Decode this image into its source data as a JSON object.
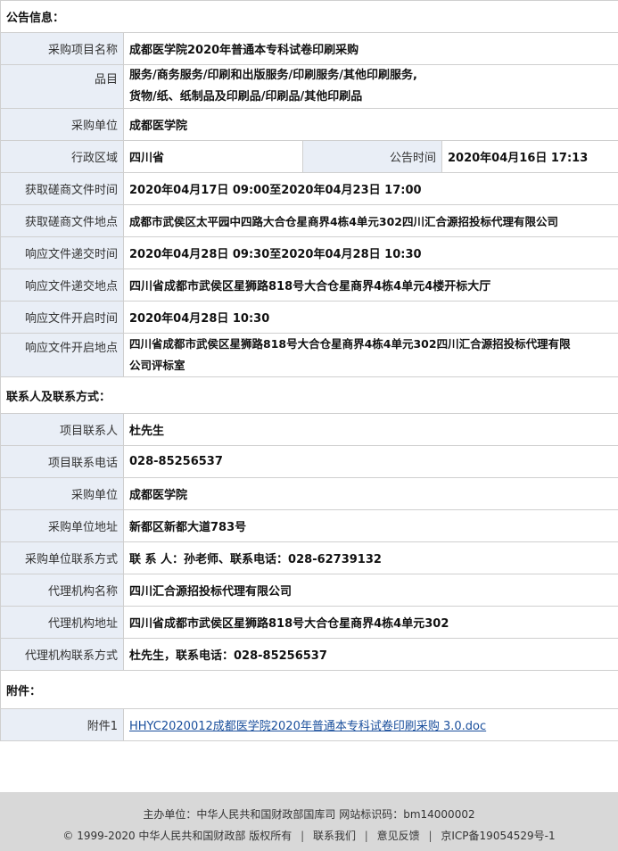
{
  "sections": {
    "announcement": "公告信息：",
    "contacts": "联系人及联系方式：",
    "attachments": "附件："
  },
  "announcement_rows": {
    "project_name": {
      "label": "采购项目名称",
      "value": "成都医学院2020年普通本专科试卷印刷采购"
    },
    "category": {
      "label": "品目",
      "value_line1": "服务/商务服务/印刷和出版服务/印刷服务/其他印刷服务,",
      "value_line2": "货物/纸、纸制品及印刷品/印刷品/其他印刷品"
    },
    "purchaser": {
      "label": "采购单位",
      "value": "成都医学院"
    },
    "region": {
      "label": "行政区域",
      "value": "四川省",
      "time_label": "公告时间",
      "time_value": "2020年04月16日 17:13"
    },
    "get_doc_time": {
      "label": "获取磋商文件时间",
      "value": "2020年04月17日 09:00至2020年04月23日 17:00"
    },
    "get_doc_place": {
      "label": "获取磋商文件地点",
      "value": "成都市武侯区太平园中四路大合仓星商界4栋4单元302四川汇合源招投标代理有限公司"
    },
    "submit_time": {
      "label": "响应文件递交时间",
      "value": "2020年04月28日 09:30至2020年04月28日 10:30"
    },
    "submit_place": {
      "label": "响应文件递交地点",
      "value": "四川省成都市武侯区星狮路818号大合仓星商界4栋4单元4楼开标大厅"
    },
    "open_time": {
      "label": "响应文件开启时间",
      "value": "2020年04月28日 10:30"
    },
    "open_place": {
      "label": "响应文件开启地点",
      "value_line1": "四川省成都市武侯区星狮路818号大合仓星商界4栋4单元302四川汇合源招投标代理有限",
      "value_line2": "公司评标室"
    }
  },
  "contact_rows": [
    {
      "label": "项目联系人",
      "value": "杜先生"
    },
    {
      "label": "项目联系电话",
      "value": "028-85256537"
    },
    {
      "label": "采购单位",
      "value": "成都医学院"
    },
    {
      "label": "采购单位地址",
      "value": "新都区新都大道783号"
    },
    {
      "label": "采购单位联系方式",
      "value": "联 系 人：孙老师、联系电话：028-62739132"
    },
    {
      "label": "代理机构名称",
      "value": "四川汇合源招投标代理有限公司"
    },
    {
      "label": "代理机构地址",
      "value": "四川省成都市武侯区星狮路818号大合仓星商界4栋4单元302"
    },
    {
      "label": "代理机构联系方式",
      "value": "杜先生，联系电话：028-85256537"
    }
  ],
  "attachment": {
    "label": "附件1",
    "link_text": "HHYC2020012成都医学院2020年普通本专科试卷印刷采购 3.0.doc"
  },
  "footer": {
    "line1": "主办单位：中华人民共和国财政部国库司  网站标识码：bm14000002",
    "copyright": "© 1999-2020 中华人民共和国财政部 版权所有",
    "contact_us": "联系我们",
    "feedback": "意见反馈",
    "icp": "京ICP备19054529号-1",
    "separator": "|"
  }
}
